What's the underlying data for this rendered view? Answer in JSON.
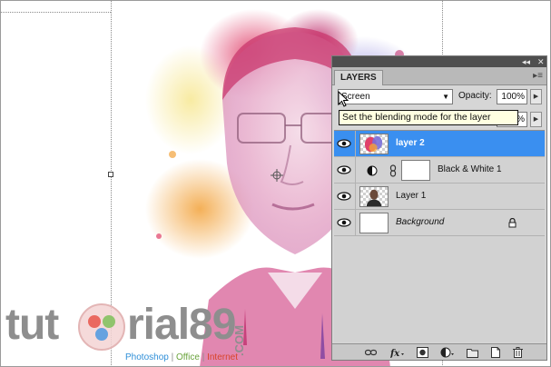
{
  "canvas": {
    "artwork_icon": "watercolor-portrait"
  },
  "watermark": {
    "text_left": "tut",
    "text_right": "rial89",
    "dot_com": ".COM",
    "tagline_photoshop": "Photoshop",
    "tagline_sep1": " | ",
    "tagline_office": "Office",
    "tagline_sep2": " | ",
    "tagline_internet": "Internet",
    "colors": {
      "photoshop": "#2f8fd8",
      "office": "#6aa33c",
      "internet": "#d9452b",
      "gray": "#8e8e8e"
    }
  },
  "panel": {
    "tab_label": "LAYERS",
    "blend_mode_value": "Screen",
    "opacity_label": "Opacity:",
    "opacity_value": "100%",
    "fill_value": "%",
    "tooltip": "Set the blending mode for the layer",
    "accent_color": "#3a8ff0",
    "layers": [
      {
        "name": "layer 2",
        "selected": true,
        "thumb": "watercolor-thumb"
      },
      {
        "name": "Black & White 1",
        "selected": false,
        "thumb": "adjustment-mask"
      },
      {
        "name": "Layer 1",
        "selected": false,
        "thumb": "portrait-thumb"
      },
      {
        "name": "Background",
        "selected": false,
        "thumb": "white",
        "locked": true
      }
    ],
    "footer_icons": [
      "link-icon",
      "fx-icon",
      "mask-icon",
      "adjustment-icon",
      "folder-icon",
      "new-layer-icon",
      "trash-icon"
    ]
  }
}
